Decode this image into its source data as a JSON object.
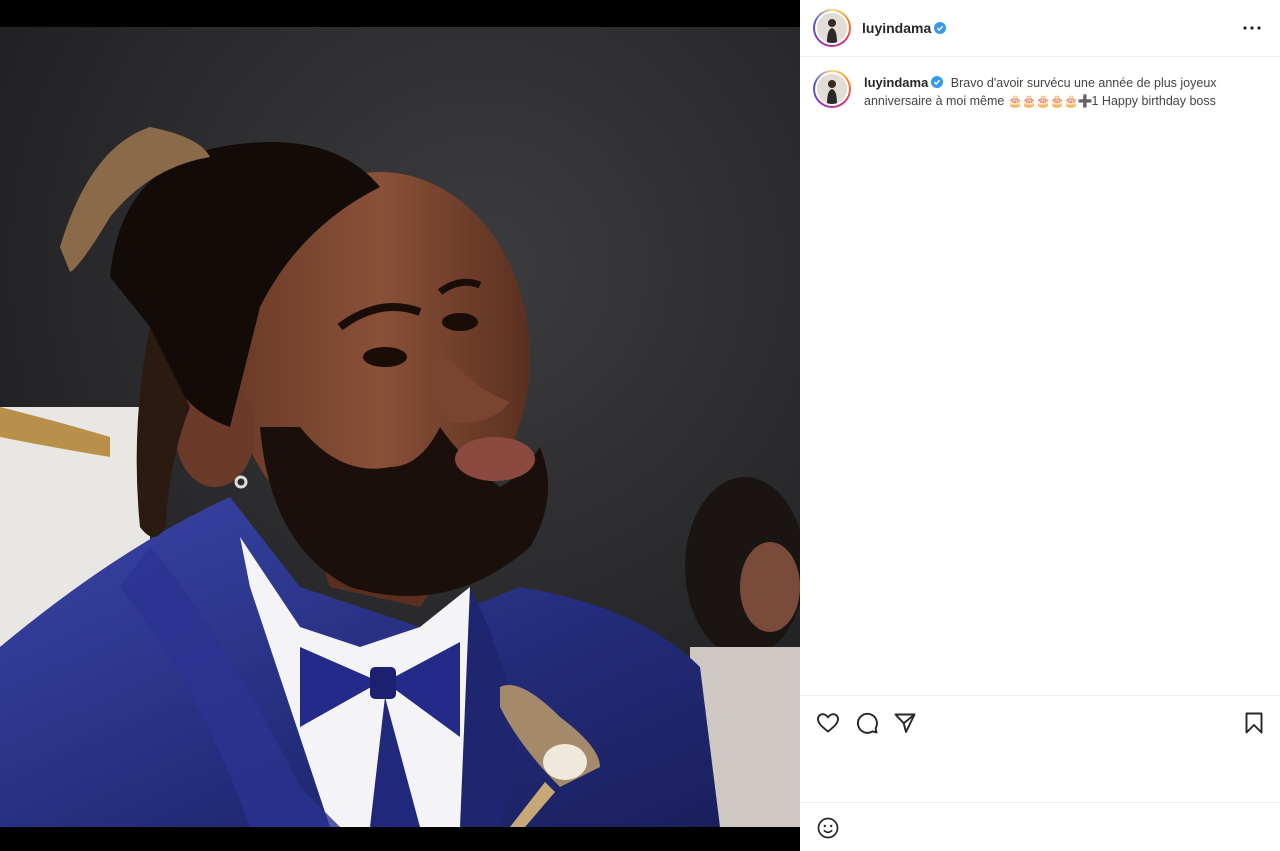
{
  "post": {
    "username": "luyindama",
    "verified": true,
    "caption": {
      "text_before": "Bravo d'avoir survécu une année de plus joyeux anniversaire à moi même",
      "emoji_cakes": "🎂🎂🎂🎂🎂",
      "emoji_plus": "➕",
      "text_after": "1 Happy birthday boss"
    }
  },
  "header": {
    "more_icon": "more-horizontal-icon"
  },
  "actions": {
    "like_icon": "heart-icon",
    "comment_icon": "comment-bubble-icon",
    "share_icon": "paper-plane-icon",
    "save_icon": "bookmark-icon"
  },
  "comment_box": {
    "emoji_icon": "smiley-icon",
    "placeholder": ""
  },
  "colors": {
    "verified_blue": "#3897f0",
    "text_primary": "#262626",
    "divider": "#efefef"
  }
}
